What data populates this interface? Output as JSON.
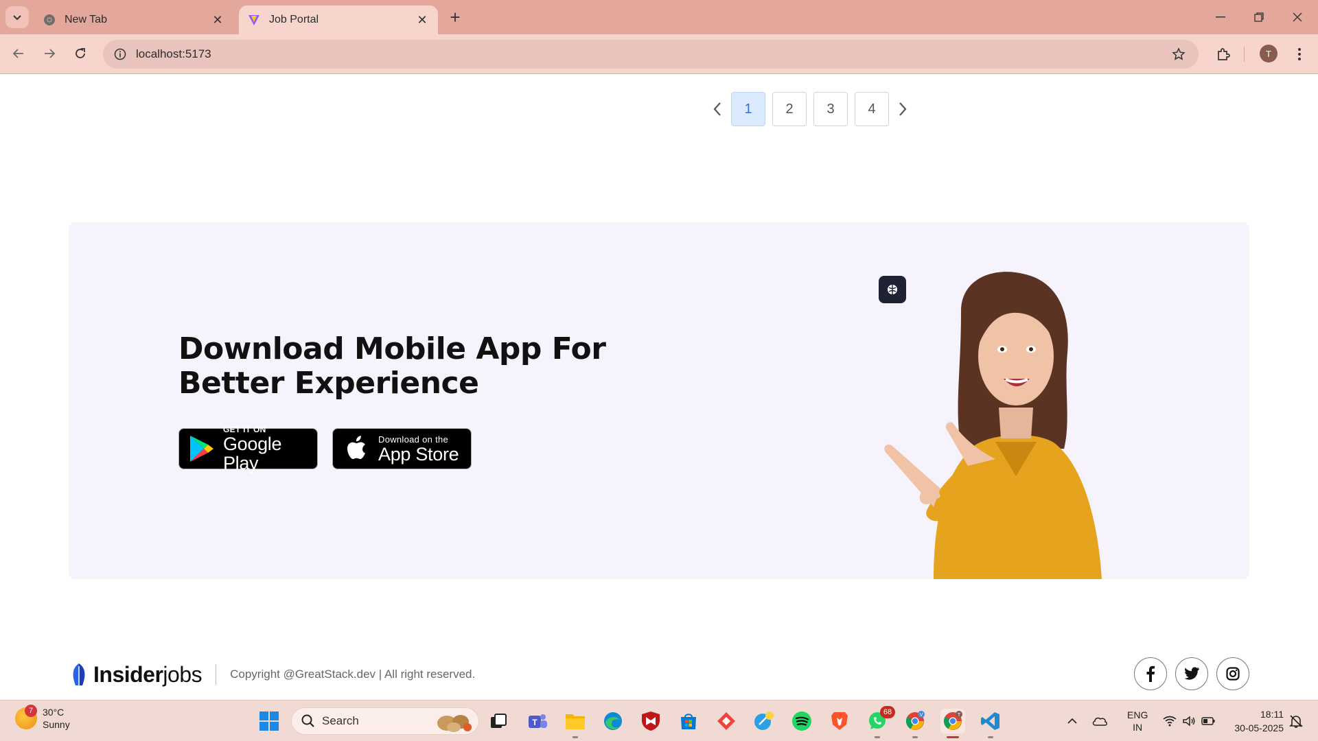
{
  "browser": {
    "tabs": [
      {
        "title": "New Tab",
        "icon": "chrome-icon",
        "active": false
      },
      {
        "title": "Job Portal",
        "icon": "vite-icon",
        "active": true
      }
    ],
    "url": "localhost:5173",
    "profile_initial": "T"
  },
  "pagination": {
    "pages": [
      "1",
      "2",
      "3",
      "4"
    ],
    "current": "1"
  },
  "banner": {
    "title_line1": "Download Mobile App For",
    "title_line2": "Better Experience",
    "google_play": {
      "small": "GET IT ON",
      "big": "Google Play"
    },
    "app_store": {
      "small": "Download on the",
      "big": "App Store"
    },
    "background_color": "#f6f3fd"
  },
  "footer": {
    "brand_bold": "Insider",
    "brand_light": "jobs",
    "copyright": "Copyright @GreatStack.dev | All right reserved.",
    "social": [
      "facebook-icon",
      "twitter-icon",
      "instagram-icon"
    ]
  },
  "taskbar": {
    "weather_temp": "30°C",
    "weather_desc": "Sunny",
    "weather_badge": "7",
    "search_label": "Search",
    "whatsapp_badge": "68",
    "lang_top": "ENG",
    "lang_bottom": "IN",
    "time": "18:11",
    "date": "30-05-2025"
  },
  "colors": {
    "chrome_tabbar": "#e3a89b",
    "chrome_toolbar": "#f7d4cc",
    "active_page": "#dbeafe",
    "taskbar": "#f1dad4"
  }
}
